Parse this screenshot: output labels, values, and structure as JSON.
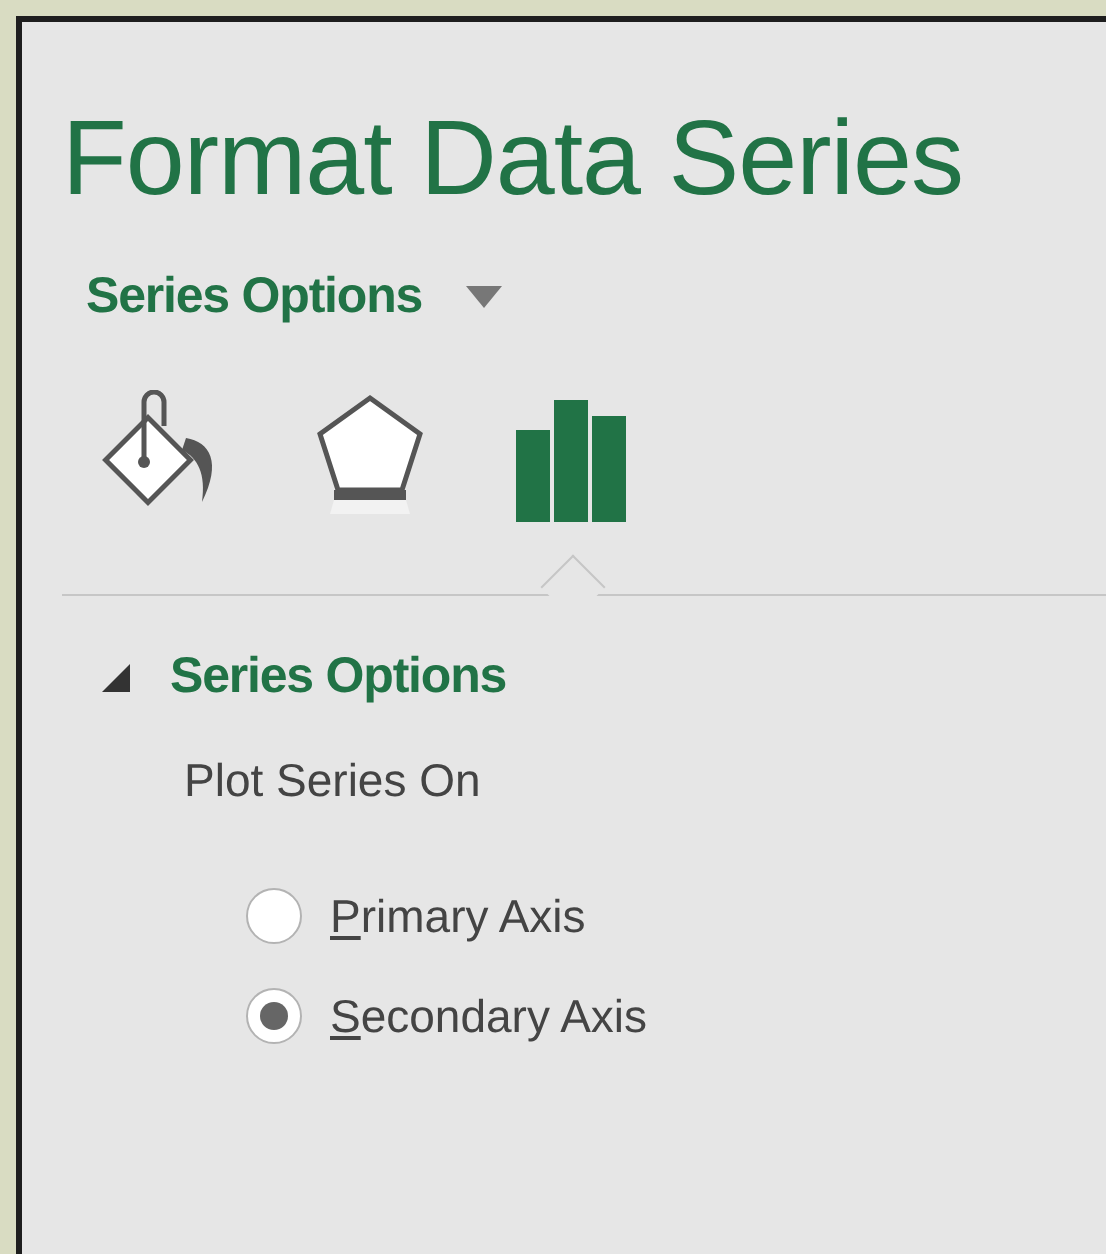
{
  "pane": {
    "title": "Format Data Series",
    "options_menu": {
      "label": "Series Options"
    },
    "tabs": [
      {
        "kind": "fill",
        "selected": false
      },
      {
        "kind": "effects",
        "selected": false
      },
      {
        "kind": "series",
        "selected": true
      }
    ],
    "section": {
      "title": "Series Options",
      "expanded": true,
      "group_label": "Plot Series On",
      "radios": [
        {
          "label": "Primary Axis",
          "selected": false
        },
        {
          "label": "Secondary Axis",
          "selected": true
        }
      ]
    }
  }
}
